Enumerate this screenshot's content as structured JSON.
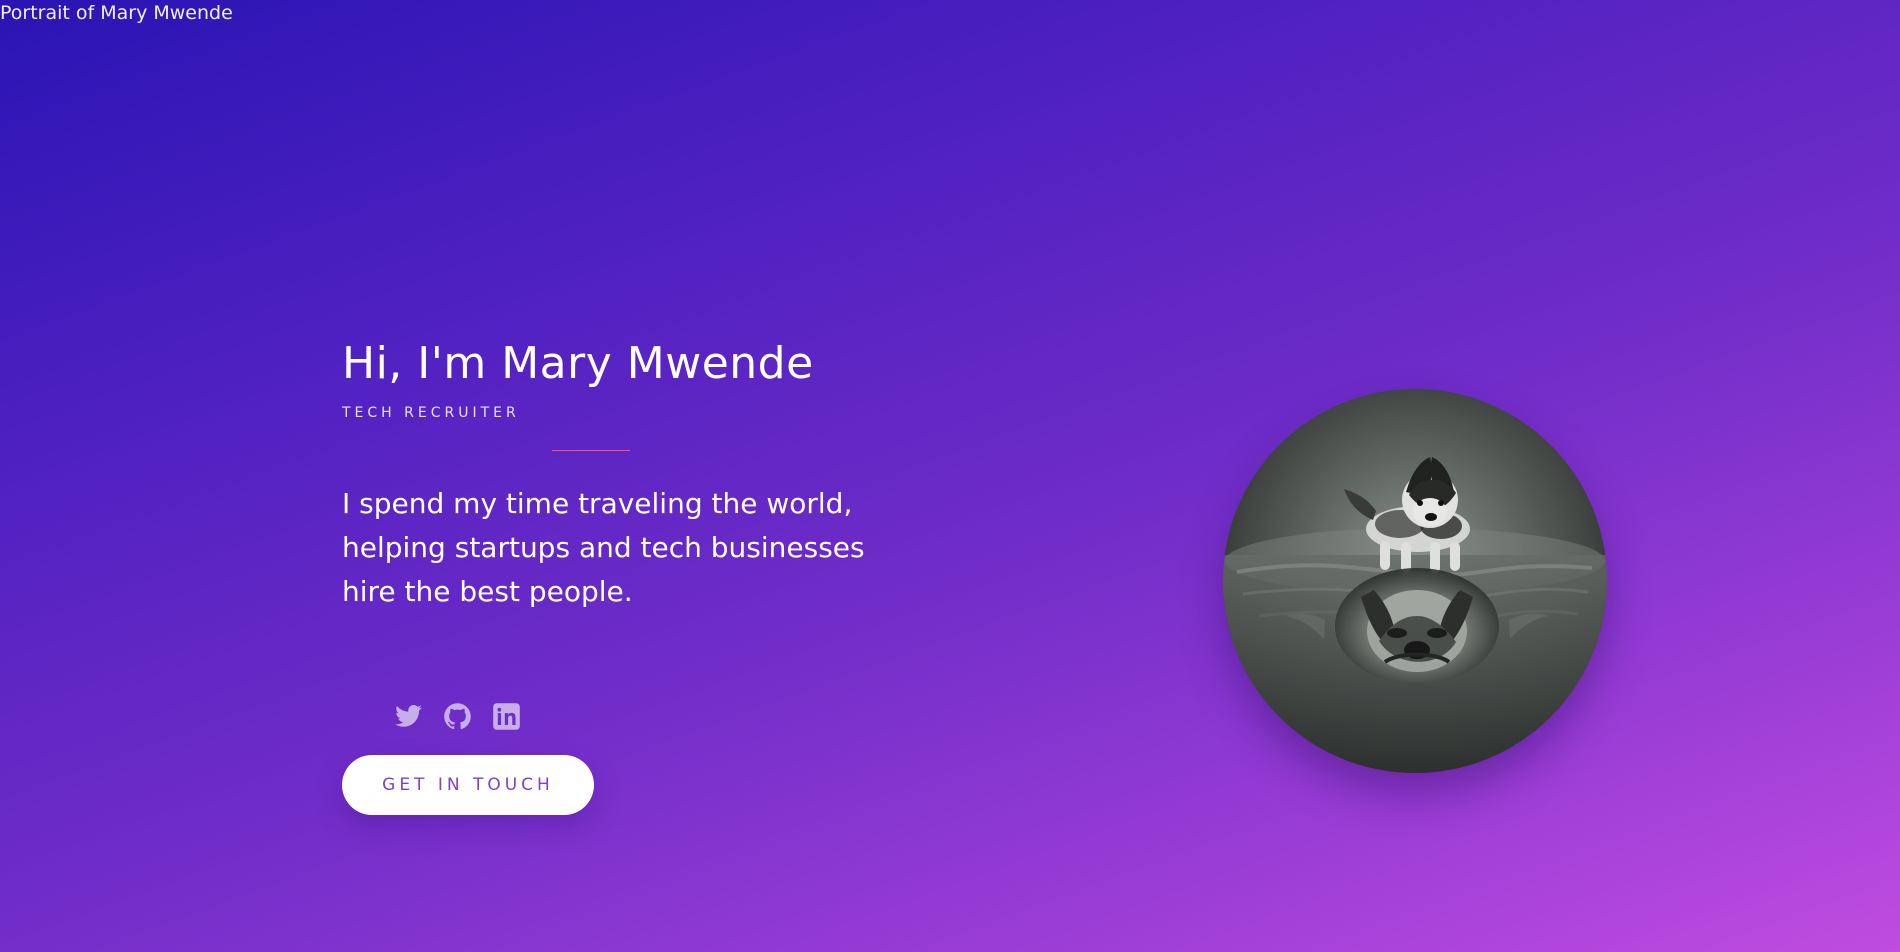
{
  "page": {
    "alt_text": "Portrait of Mary Mwende"
  },
  "hero": {
    "title": "Hi, I'm Mary Mwende",
    "subtitle": "TECH RECRUITER",
    "description": "I spend my time traveling the world, helping startups and tech businesses hire the best people.",
    "cta_label": "GET IN TOUCH"
  },
  "social": [
    {
      "icon": "twitter-icon"
    },
    {
      "icon": "github-icon"
    },
    {
      "icon": "linkedin-icon"
    }
  ],
  "portrait": {
    "description_icon": "portrait-image"
  },
  "colors": {
    "background_start": "#2a14b4",
    "background_end": "#c04ce0",
    "accent_divider": "#ff4f6d",
    "button_text": "#7f3fd1"
  }
}
